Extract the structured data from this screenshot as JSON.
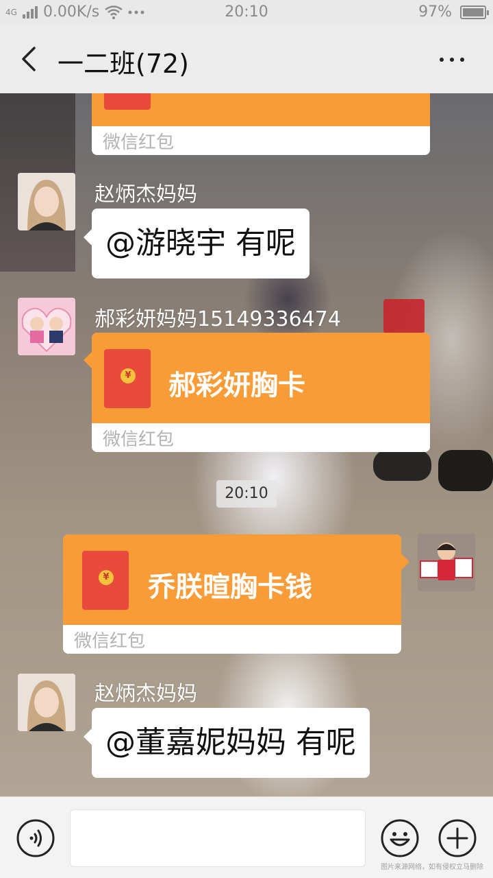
{
  "status_bar": {
    "network_gen": "4G",
    "speed": "0.00K/s",
    "time": "20:10",
    "battery": "97%"
  },
  "nav": {
    "title": "一二班(72)"
  },
  "messages": [
    {
      "type": "red_packet",
      "side": "left",
      "title": "",
      "footer": "微信红包"
    },
    {
      "type": "text",
      "side": "left",
      "sender": "赵炳杰妈妈",
      "text": "@游晓宇  有呢",
      "avatar_icon": "woman-avatar"
    },
    {
      "type": "red_packet",
      "side": "left",
      "sender": "郝彩妍妈妈15149336474",
      "title": "郝彩妍胸卡",
      "footer": "微信红包",
      "avatar_icon": "kids-avatar"
    },
    {
      "type": "time",
      "text": "20:10"
    },
    {
      "type": "red_packet",
      "side": "right",
      "title": "乔朕暄胸卡钱",
      "footer": "微信红包",
      "avatar_icon": "child-certificate-avatar"
    },
    {
      "type": "text",
      "side": "left",
      "sender": "赵炳杰妈妈",
      "text": "@董嘉妮妈妈  有呢",
      "avatar_icon": "woman-avatar"
    }
  ],
  "input_bar": {
    "value": "",
    "voice_icon": "voice-icon",
    "emoji_icon": "emoji-icon",
    "plus_icon": "plus-icon",
    "watermark": "图片来源网络，如有侵权立马删除"
  },
  "colors": {
    "red_packet": "#f99c38",
    "envelope": "#e84a3c",
    "nav_bg": "#ececec"
  }
}
